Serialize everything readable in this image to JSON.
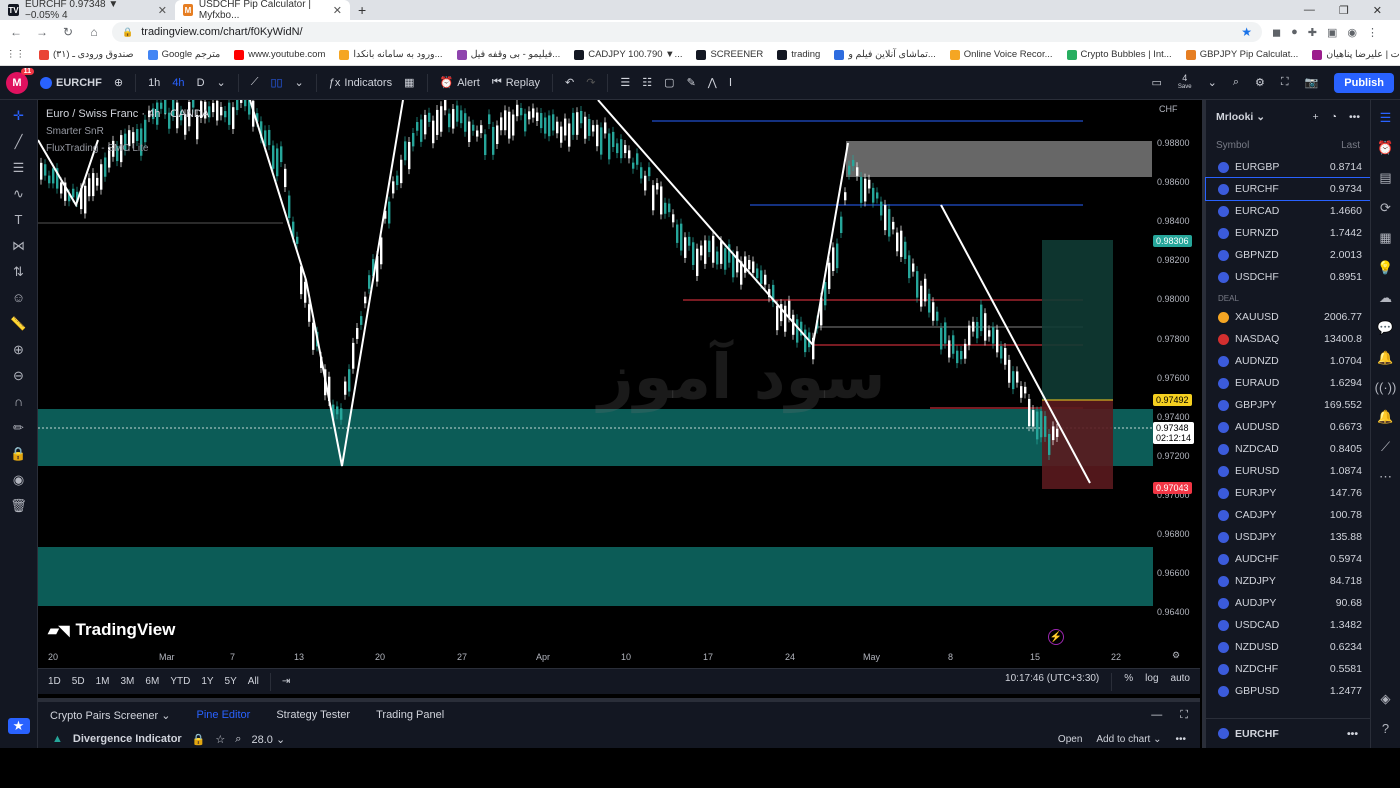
{
  "browser": {
    "tabs": [
      {
        "title": "EURCHF 0.97348 ▼ −0.05% 4",
        "active": false,
        "icon": "tv"
      },
      {
        "title": "USDCHF Pip Calculator | Myfxbo...",
        "active": true,
        "icon": "myfx"
      }
    ],
    "url": "tradingview.com/chart/f0KyWidN/",
    "bookmarks": [
      "صندوق ورودی ـ (۳۱)",
      "Google مترجم",
      "www.youtube.com",
      "ورود به سامانه بانکدا...",
      "فیلیمو - بی وقفه فیل...",
      "CADJPY 100.790 ▼...",
      "SCREENER",
      "trading",
      "تماشای آنلاین فیلم و...",
      "Online Voice Recor...",
      "Crypto Bubbles | Int...",
      "GBPJPY Pip Calculat...",
      "آپارات | علیرضا پناهیان"
    ]
  },
  "toolbar": {
    "avatar_letter": "M",
    "avatar_badge": "11",
    "symbol": "EURCHF",
    "intervals": [
      "1h",
      "4h",
      "D"
    ],
    "indicators_label": "Indicators",
    "alert_label": "Alert",
    "replay_label": "Replay",
    "save_count": "4",
    "save_label": "Save",
    "publish_label": "Publish"
  },
  "chart": {
    "title": "Euro / Swiss Franc · 4h · OANDA",
    "indicator1": "Smarter SnR",
    "indicator2": "FluxTrading - SMC Lite",
    "currency": "CHF",
    "watermark": "سود آموز",
    "brand": "TradingView",
    "price_labels": [
      "0.98800",
      "0.98600",
      "0.98400",
      "0.98200",
      "0.98000",
      "0.97800",
      "0.97600",
      "0.97400",
      "0.97200",
      "0.97000",
      "0.96800",
      "0.96600",
      "0.96400"
    ],
    "tag_top": "0.98306",
    "tag_target": "0.97492",
    "tag_current": "0.97348",
    "tag_countdown": "02:12:14",
    "tag_stop": "0.97043",
    "time_labels": [
      "20",
      "Mar",
      "7",
      "13",
      "20",
      "27",
      "Apr",
      "10",
      "17",
      "24",
      "May",
      "8",
      "15",
      "22"
    ]
  },
  "range_bar": {
    "ranges": [
      "1D",
      "5D",
      "1M",
      "3M",
      "6M",
      "YTD",
      "1Y",
      "5Y",
      "All"
    ],
    "clock": "10:17:46 (UTC+3:30)",
    "percent": "%",
    "log": "log",
    "auto": "auto"
  },
  "bottom_panel": {
    "tabs": [
      "Crypto Pairs Screener",
      "Pine Editor",
      "Strategy Tester",
      "Trading Panel"
    ],
    "active_tab": "Pine Editor",
    "script_name": "Divergence Indicator",
    "zoom": "28.0",
    "open_label": "Open",
    "add_label": "Add to chart"
  },
  "watchlist": {
    "name": "Mrlooki",
    "col_symbol": "Symbol",
    "col_last": "Last",
    "section_deal": "DEAL",
    "group1": [
      {
        "symbol": "EURGBP",
        "last": "0.8714"
      },
      {
        "symbol": "EURCHF",
        "last": "0.9734",
        "selected": true
      },
      {
        "symbol": "EURCAD",
        "last": "1.4660"
      },
      {
        "symbol": "EURNZD",
        "last": "1.7442"
      },
      {
        "symbol": "GBPNZD",
        "last": "2.0013"
      },
      {
        "symbol": "USDCHF",
        "last": "0.8951"
      }
    ],
    "group2": [
      {
        "symbol": "XAUUSD",
        "last": "2006.77",
        "icon": "gold"
      },
      {
        "symbol": "NASDAQ",
        "last": "13400.8",
        "icon": "red"
      },
      {
        "symbol": "AUDNZD",
        "last": "1.0704"
      },
      {
        "symbol": "EURAUD",
        "last": "1.6294"
      },
      {
        "symbol": "GBPJPY",
        "last": "169.552"
      },
      {
        "symbol": "AUDUSD",
        "last": "0.6673"
      },
      {
        "symbol": "NZDCAD",
        "last": "0.8405"
      },
      {
        "symbol": "EURUSD",
        "last": "1.0874"
      },
      {
        "symbol": "EURJPY",
        "last": "147.76"
      },
      {
        "symbol": "CADJPY",
        "last": "100.78"
      },
      {
        "symbol": "USDJPY",
        "last": "135.88"
      },
      {
        "symbol": "AUDCHF",
        "last": "0.5974"
      },
      {
        "symbol": "NZDJPY",
        "last": "84.718"
      },
      {
        "symbol": "AUDJPY",
        "last": "90.68"
      },
      {
        "symbol": "USDCAD",
        "last": "1.3482"
      },
      {
        "symbol": "NZDUSD",
        "last": "0.6234"
      },
      {
        "symbol": "NZDCHF",
        "last": "0.5581"
      },
      {
        "symbol": "GBPUSD",
        "last": "1.2477"
      }
    ],
    "footer_symbol": "EURCHF"
  },
  "colors": {
    "zone": "#0f6e6a",
    "candle_up": "#26a69a",
    "accent": "#2962ff",
    "stop": "#f23645"
  }
}
